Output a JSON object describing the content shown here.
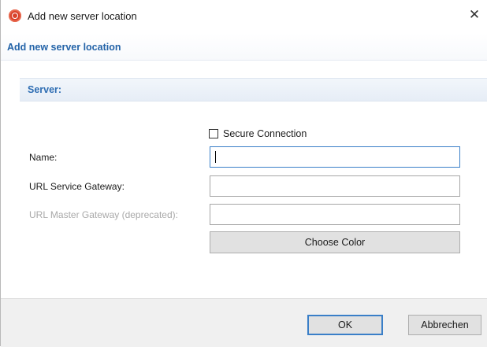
{
  "window": {
    "title": "Add new server location",
    "close_glyph": "✕",
    "app_icon": "app-logo-icon"
  },
  "header": {
    "title": "Add new server location"
  },
  "section": {
    "title": "Server:"
  },
  "form": {
    "secure_connection": {
      "label": "Secure Connection",
      "checked": false
    },
    "name": {
      "label": "Name:",
      "value": ""
    },
    "url_service_gateway": {
      "label": "URL Service Gateway:",
      "value": ""
    },
    "url_master_gateway": {
      "label": "URL Master Gateway (deprecated):",
      "value": "",
      "disabled": true
    },
    "choose_color_label": "Choose Color"
  },
  "footer": {
    "ok_label": "OK",
    "cancel_label": "Abbrechen"
  },
  "colors": {
    "accent_blue": "#2363a8",
    "focus_border": "#3a7fc8",
    "app_icon_red": "#d9412a",
    "disabled_text": "#a9a9a9"
  }
}
